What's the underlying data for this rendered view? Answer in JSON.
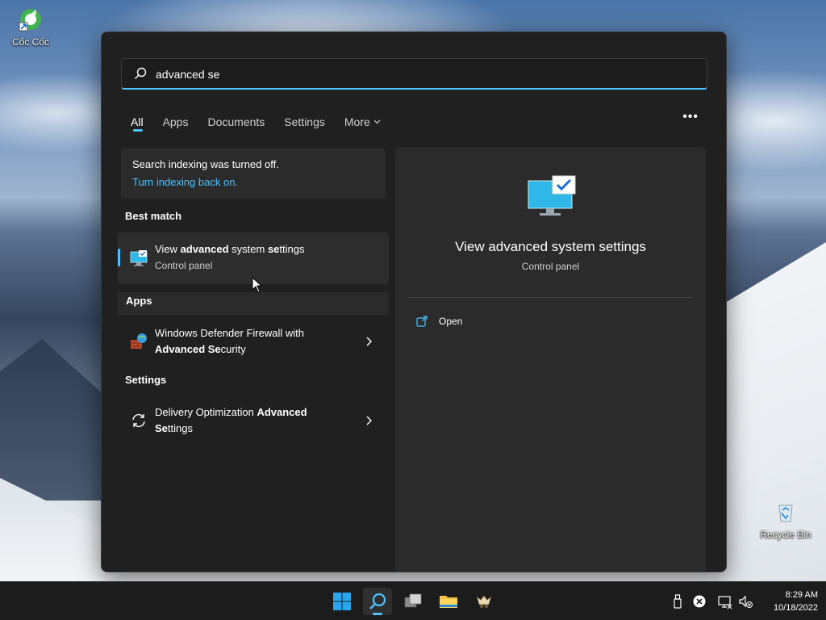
{
  "desktop": {
    "icons": [
      {
        "label": "Cốc Cốc"
      },
      {
        "label": "Recycle Bin"
      }
    ]
  },
  "search": {
    "query": "advanced se"
  },
  "tabs": [
    {
      "label": "All",
      "active": true
    },
    {
      "label": "Apps"
    },
    {
      "label": "Documents"
    },
    {
      "label": "Settings"
    },
    {
      "label": "More"
    }
  ],
  "more_options_label": "•••",
  "notice": {
    "line1": "Search indexing was turned off.",
    "line2": "Turn indexing back on."
  },
  "sections": {
    "best_match": "Best match",
    "apps": "Apps",
    "settings": "Settings"
  },
  "results": {
    "best": {
      "title_pre": "View ",
      "title_bold": "advanced",
      "title_mid": " system ",
      "title_bold2": "se",
      "title_post": "ttings",
      "subtitle": "Control panel"
    },
    "firewall": {
      "title_line1": "Windows Defender Firewall with",
      "title_bold": "Advanced Se",
      "title_post": "curity"
    },
    "delivery": {
      "title_pre": "Delivery Optimization ",
      "title_bold": "Advanced",
      "title_bold2": "Se",
      "title_post": "ttings"
    }
  },
  "detail": {
    "title": "View advanced system settings",
    "subtitle": "Control panel",
    "actions": [
      {
        "label": "Open"
      }
    ]
  },
  "taskbar": {
    "time": "8:29 AM",
    "date": "10/18/2022"
  },
  "colors": {
    "accent": "#4cc2ff",
    "panel_bg": "#202020",
    "pane_bg": "#2b2b2b"
  }
}
